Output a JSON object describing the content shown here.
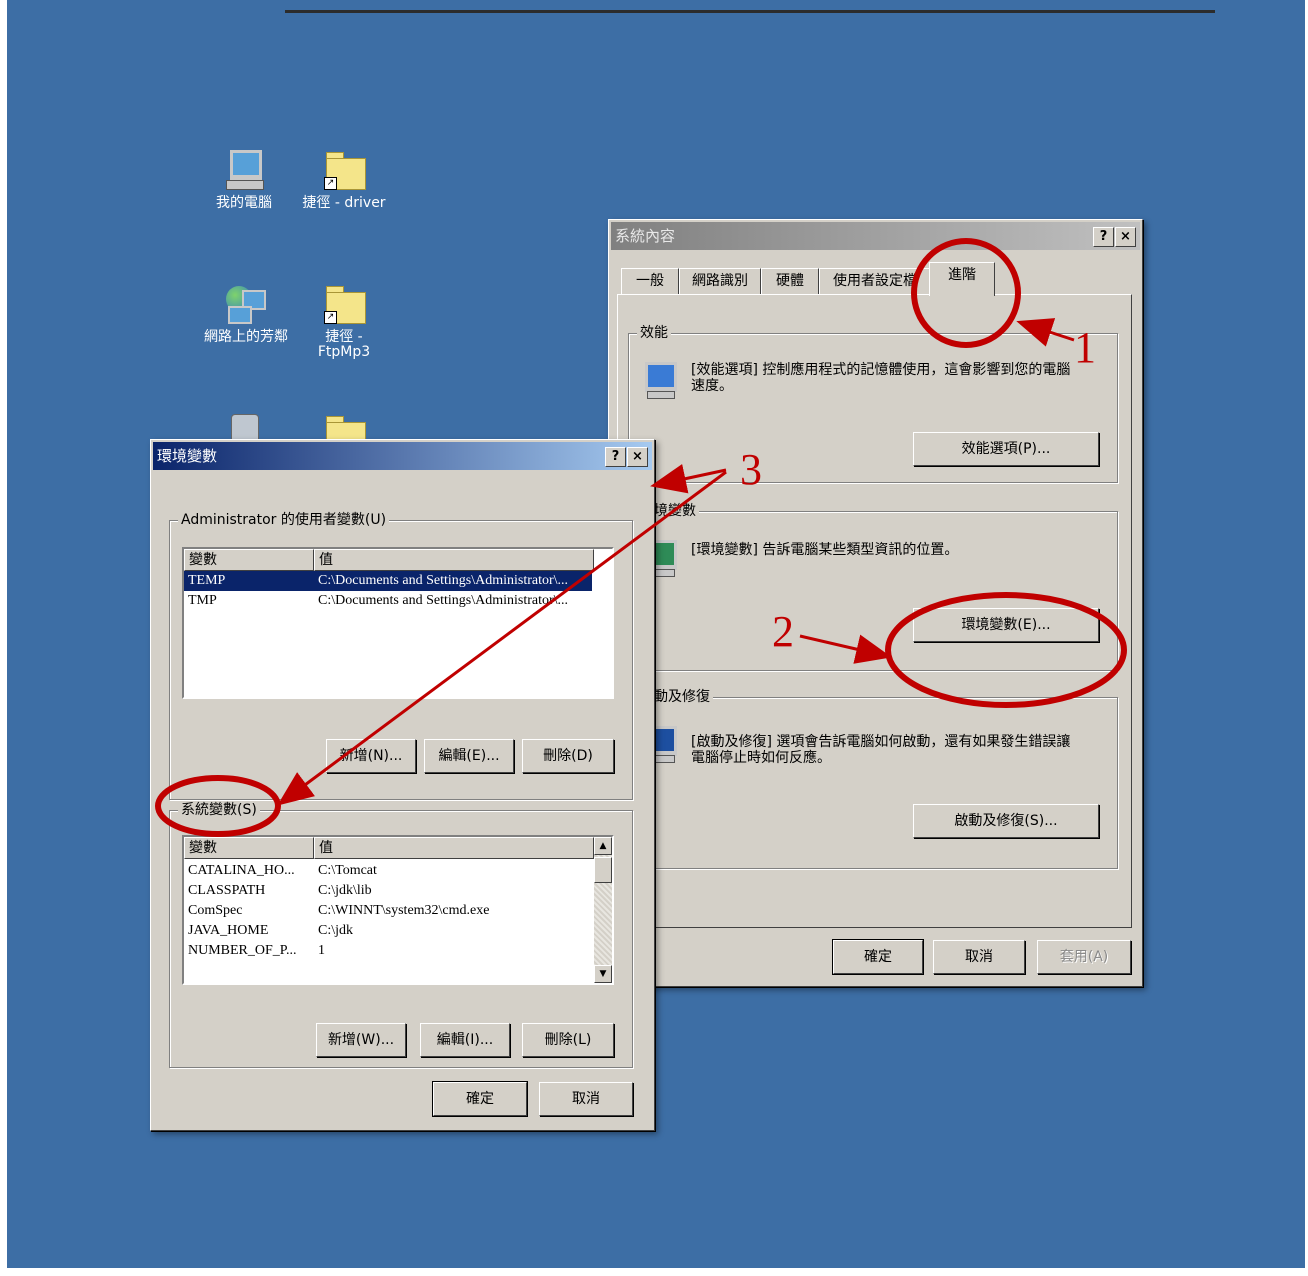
{
  "desktop": {
    "icons": [
      {
        "label": "我的電腦"
      },
      {
        "label": "捷徑 - driver"
      },
      {
        "label": "網路上的芳鄰"
      },
      {
        "label": "捷徑 - FtpMp3"
      }
    ]
  },
  "system_properties": {
    "title": "系統內容",
    "help_btn": "?",
    "close_btn": "×",
    "tabs": [
      "一般",
      "網路識別",
      "硬體",
      "使用者設定檔",
      "進階"
    ],
    "selected_tab": "進階",
    "performance": {
      "group_label": "效能",
      "description": "[效能選項] 控制應用程式的記憶體使用，這會影響到您的電腦速度。",
      "button": "效能選項(P)..."
    },
    "environment": {
      "group_label": "環境變數",
      "description": "[環境變數] 告訴電腦某些類型資訊的位置。",
      "button": "環境變數(E)..."
    },
    "startup": {
      "group_label": "啟動及修復",
      "description": "[啟動及修復] 選項會告訴電腦如何啟動，還有如果發生錯誤讓電腦停止時如何反應。",
      "button": "啟動及修復(S)..."
    },
    "ok": "確定",
    "cancel": "取消",
    "apply": "套用(A)"
  },
  "env_vars": {
    "title": "環境變數",
    "help_btn": "?",
    "close_btn": "×",
    "user_group_label": "Administrator 的使用者變數(U)",
    "columns": [
      "變數",
      "值"
    ],
    "user_vars": [
      {
        "name": "TEMP",
        "value": "C:\\Documents and Settings\\Administrator\\..."
      },
      {
        "name": "TMP",
        "value": "C:\\Documents and Settings\\Administrator\\..."
      }
    ],
    "user_buttons": {
      "new": "新增(N)...",
      "edit": "編輯(E)...",
      "delete": "刪除(D)"
    },
    "system_group_label": "系統變數(S)",
    "system_vars": [
      {
        "name": "CATALINA_HO...",
        "value": "C:\\Tomcat"
      },
      {
        "name": "CLASSPATH",
        "value": "C:\\jdk\\lib"
      },
      {
        "name": "ComSpec",
        "value": "C:\\WINNT\\system32\\cmd.exe"
      },
      {
        "name": "JAVA_HOME",
        "value": "C:\\jdk"
      },
      {
        "name": "NUMBER_OF_P...",
        "value": "1"
      }
    ],
    "system_buttons": {
      "new": "新增(W)...",
      "edit": "編輯(I)...",
      "delete": "刪除(L)"
    },
    "ok": "確定",
    "cancel": "取消"
  },
  "annotations": {
    "labels": [
      "1",
      "2",
      "3"
    ],
    "color": "#c00000"
  }
}
